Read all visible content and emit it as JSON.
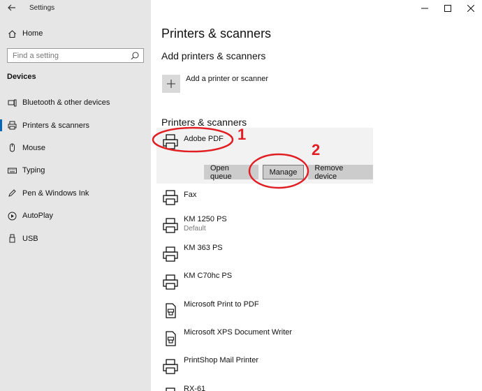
{
  "window": {
    "title": "Settings"
  },
  "sidebar": {
    "home_label": "Home",
    "search_placeholder": "Find a setting",
    "section_title": "Devices",
    "items": [
      {
        "label": "Bluetooth & other devices",
        "icon": "bluetooth-icon",
        "active": false
      },
      {
        "label": "Printers & scanners",
        "icon": "printer-icon",
        "active": true
      },
      {
        "label": "Mouse",
        "icon": "mouse-icon",
        "active": false
      },
      {
        "label": "Typing",
        "icon": "keyboard-icon",
        "active": false
      },
      {
        "label": "Pen & Windows Ink",
        "icon": "pen-icon",
        "active": false
      },
      {
        "label": "AutoPlay",
        "icon": "autoplay-icon",
        "active": false
      },
      {
        "label": "USB",
        "icon": "usb-icon",
        "active": false
      }
    ]
  },
  "main": {
    "title": "Printers & scanners",
    "add_section_title": "Add printers & scanners",
    "add_label": "Add a printer or scanner",
    "list_title": "Printers & scanners",
    "printers": [
      {
        "name": "Adobe PDF",
        "sub": ""
      },
      {
        "name": "Fax",
        "sub": ""
      },
      {
        "name": "KM 1250 PS",
        "sub": "Default"
      },
      {
        "name": "KM 363 PS",
        "sub": ""
      },
      {
        "name": "KM C70hc PS",
        "sub": ""
      },
      {
        "name": "Microsoft Print to PDF",
        "sub": ""
      },
      {
        "name": "Microsoft XPS Document Writer",
        "sub": ""
      },
      {
        "name": "PrintShop Mail Printer",
        "sub": ""
      },
      {
        "name": "RX-61",
        "sub": ""
      }
    ],
    "buttons": {
      "open_queue": "Open queue",
      "manage": "Manage",
      "remove": "Remove device"
    }
  },
  "annotations": {
    "step1": "1",
    "step2": "2",
    "color": "#e01e24"
  }
}
